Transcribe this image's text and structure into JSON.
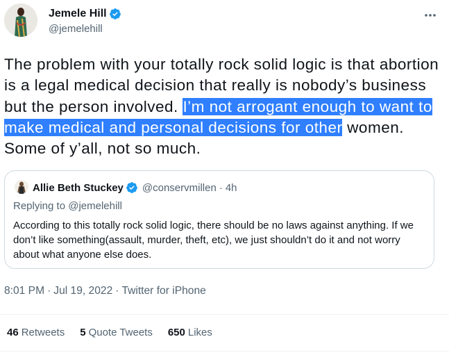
{
  "author": {
    "display_name": "Jemele Hill",
    "handle": "@jemelehill",
    "avatar_icon": "person-avatar",
    "verified_icon": "verified-badge-icon"
  },
  "tweet": {
    "text_before_selection": "The problem with your totally rock solid logic is that abortion is a legal medical decision that really is nobody’s business but the person involved. ",
    "text_selected": "I’m not arrogant enough to want to make medical and personal decisions for other",
    "text_after_selection": " women. Some of y’all, not so much."
  },
  "quote": {
    "display_name": "Allie Beth Stuckey",
    "handle": "@conservmillen",
    "separator": "·",
    "time": "4h",
    "replying_to": "Replying to @jemelehill",
    "text": "According to this totally rock solid logic, there should be no laws against anything. If we don’t like something(assault, murder, theft, etc), we just shouldn’t do it and not worry about what anyone else does."
  },
  "meta": {
    "time": "8:01 PM",
    "sep1": "·",
    "date": "Jul 19, 2022",
    "sep2": "·",
    "source": "Twitter for iPhone"
  },
  "stats": {
    "retweets": {
      "count": "46",
      "label": "Retweets"
    },
    "quote_tweets": {
      "count": "5",
      "label": "Quote Tweets"
    },
    "likes": {
      "count": "650",
      "label": "Likes"
    }
  },
  "colors": {
    "verified": "#1d9bf0",
    "selection": "#2f7fff",
    "secondary_text": "#536471",
    "border": "#cfd9de"
  }
}
